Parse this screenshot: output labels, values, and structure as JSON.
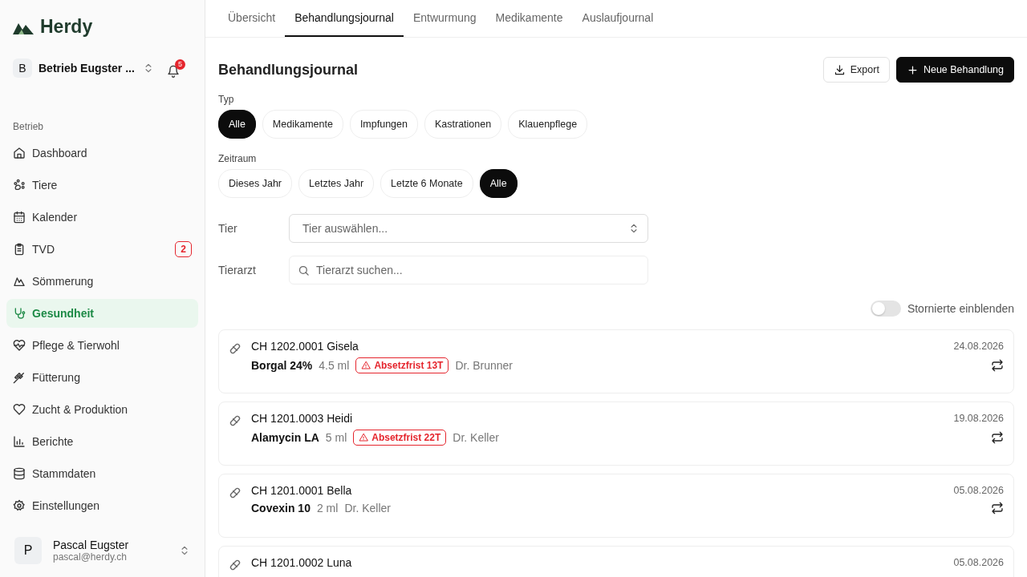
{
  "sidebar": {
    "brand": "Herdy",
    "farm": {
      "initial": "B",
      "name": "Betrieb Eugster ..."
    },
    "notifications": "5",
    "section": "Betrieb",
    "items": [
      {
        "label": "Dashboard",
        "selected": false
      },
      {
        "label": "Tiere",
        "selected": false
      },
      {
        "label": "Kalender",
        "selected": false
      },
      {
        "label": "TVD",
        "selected": false,
        "badge": "2"
      },
      {
        "label": "Sömmerung",
        "selected": false
      },
      {
        "label": "Gesundheit",
        "selected": true
      },
      {
        "label": "Pflege & Tierwohl",
        "selected": false
      },
      {
        "label": "Fütterung",
        "selected": false
      },
      {
        "label": "Zucht & Produktion",
        "selected": false
      },
      {
        "label": "Berichte",
        "selected": false
      },
      {
        "label": "Stammdaten",
        "selected": false
      },
      {
        "label": "Einstellungen",
        "selected": false
      }
    ],
    "user": {
      "initial": "P",
      "name": "Pascal Eugster",
      "email": "pascal@herdy.ch"
    }
  },
  "tabs": [
    {
      "label": "Übersicht",
      "selected": false
    },
    {
      "label": "Behandlungsjournal",
      "selected": true
    },
    {
      "label": "Entwurmung",
      "selected": false
    },
    {
      "label": "Medikamente",
      "selected": false
    },
    {
      "label": "Auslaufjournal",
      "selected": false
    }
  ],
  "title": "Behandlungsjournal",
  "buttons": {
    "export": "Export",
    "new": "Neue Behandlung"
  },
  "filters": [
    {
      "label": "Typ",
      "chips": [
        {
          "label": "Alle",
          "selected": true
        },
        {
          "label": "Medikamente",
          "selected": false
        },
        {
          "label": "Impfungen",
          "selected": false
        },
        {
          "label": "Kastrationen",
          "selected": false
        },
        {
          "label": "Klauenpflege",
          "selected": false
        }
      ]
    },
    {
      "label": "Zeitraum",
      "chips": [
        {
          "label": "Dieses Jahr",
          "selected": false
        },
        {
          "label": "Letztes Jahr",
          "selected": false
        },
        {
          "label": "Letzte 6 Monate",
          "selected": false
        },
        {
          "label": "Alle",
          "selected": true
        }
      ]
    }
  ],
  "animal": {
    "label": "Tier",
    "placeholder": "Tier auswählen..."
  },
  "vet": {
    "label": "Tierarzt",
    "placeholder": "Tierarzt suchen..."
  },
  "show_cancelled": {
    "label": "Stornierte einblenden",
    "on": false
  },
  "entries": [
    {
      "animal": "CH 1202.0001 Gisela",
      "date": "24.08.2026",
      "drug": "Borgal 24%",
      "dose": "4.5 ml",
      "warning": "Absetzfrist 13T",
      "vet": "Dr. Brunner"
    },
    {
      "animal": "CH 1201.0003 Heidi",
      "date": "19.08.2026",
      "drug": "Alamycin LA",
      "dose": "5 ml",
      "warning": "Absetzfrist 22T",
      "vet": "Dr. Keller"
    },
    {
      "animal": "CH 1201.0001 Bella",
      "date": "05.08.2026",
      "drug": "Covexin 10",
      "dose": "2 ml",
      "vet": "Dr. Keller"
    },
    {
      "animal": "CH 1201.0002 Luna",
      "date": "05.08.2026"
    }
  ]
}
